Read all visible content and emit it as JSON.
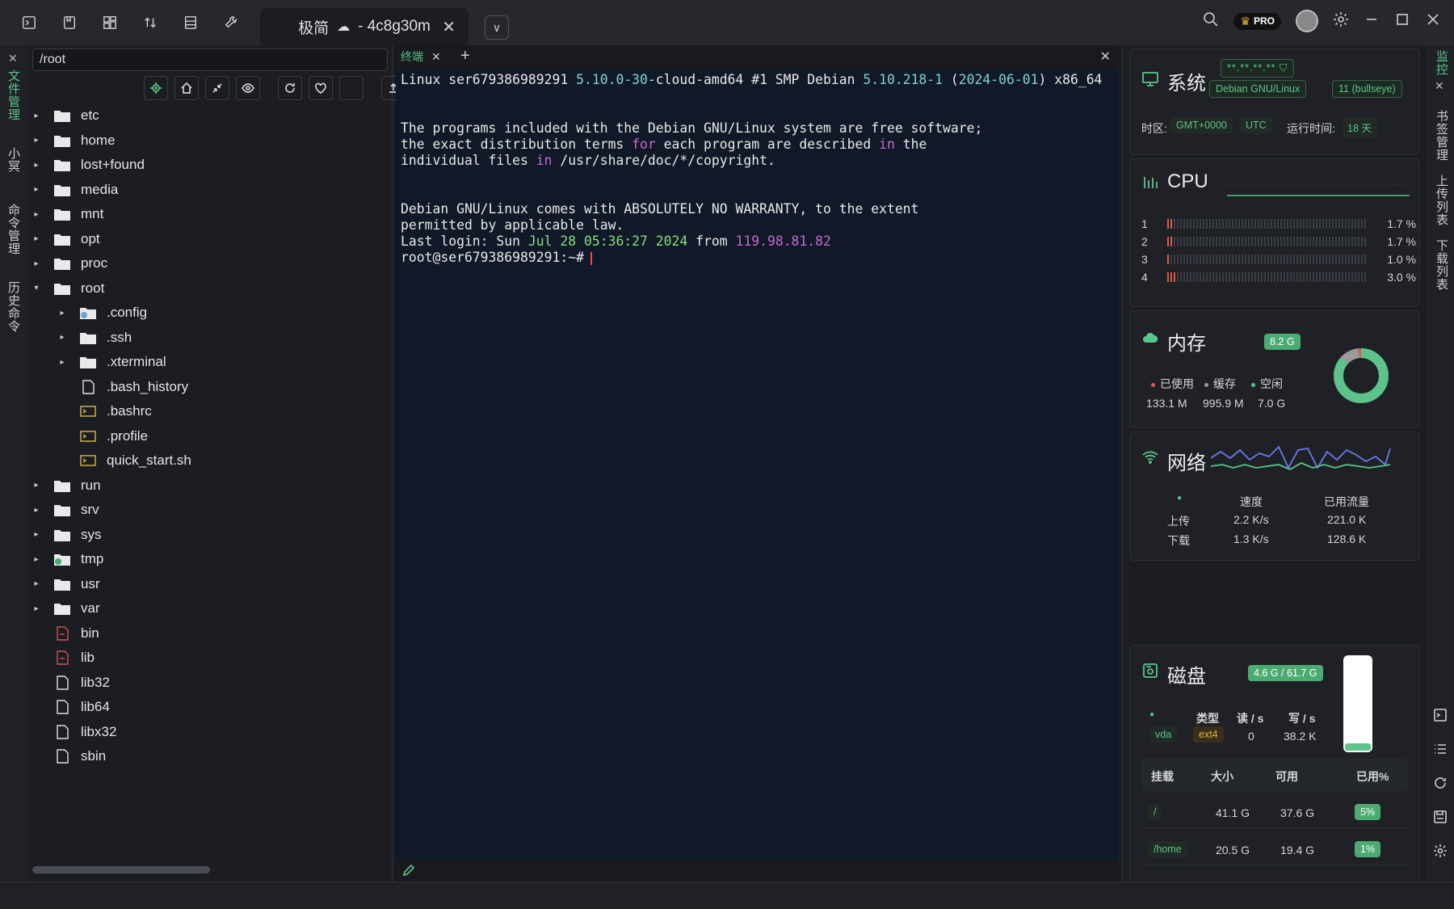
{
  "tab": {
    "title": "极简",
    "host": "- 4c8g30m"
  },
  "left_tabs": [
    "文件管理",
    "小冥",
    "命令管理",
    "历史命令"
  ],
  "right_tabs": [
    "监控",
    "书签管理",
    "上传列表",
    "下载列表"
  ],
  "file_panel": {
    "path": "/root",
    "items": [
      {
        "name": "etc",
        "type": "folder",
        "depth": 0,
        "arrow": "▸"
      },
      {
        "name": "home",
        "type": "folder",
        "depth": 0,
        "arrow": "▸"
      },
      {
        "name": "lost+found",
        "type": "folder",
        "depth": 0,
        "arrow": "▸"
      },
      {
        "name": "media",
        "type": "folder",
        "depth": 0,
        "arrow": "▸"
      },
      {
        "name": "mnt",
        "type": "folder",
        "depth": 0,
        "arrow": "▸"
      },
      {
        "name": "opt",
        "type": "folder",
        "depth": 0,
        "arrow": "▸"
      },
      {
        "name": "proc",
        "type": "folder",
        "depth": 0,
        "arrow": "▸"
      },
      {
        "name": "root",
        "type": "folder",
        "depth": 0,
        "arrow": "▾"
      },
      {
        "name": ".config",
        "type": "folder-gear",
        "depth": 1,
        "arrow": "▸"
      },
      {
        "name": ".ssh",
        "type": "folder",
        "depth": 1,
        "arrow": "▸"
      },
      {
        "name": ".xterminal",
        "type": "folder",
        "depth": 1,
        "arrow": "▸"
      },
      {
        "name": ".bash_history",
        "type": "file",
        "depth": 1,
        "arrow": ""
      },
      {
        "name": ".bashrc",
        "type": "shell",
        "depth": 1,
        "arrow": ""
      },
      {
        "name": ".profile",
        "type": "shell",
        "depth": 1,
        "arrow": ""
      },
      {
        "name": "quick_start.sh",
        "type": "shell",
        "depth": 1,
        "arrow": ""
      },
      {
        "name": "run",
        "type": "folder",
        "depth": 0,
        "arrow": "▸"
      },
      {
        "name": "srv",
        "type": "folder",
        "depth": 0,
        "arrow": "▸"
      },
      {
        "name": "sys",
        "type": "folder",
        "depth": 0,
        "arrow": "▸"
      },
      {
        "name": "tmp",
        "type": "folder-clock",
        "depth": 0,
        "arrow": "▸"
      },
      {
        "name": "usr",
        "type": "folder",
        "depth": 0,
        "arrow": "▸"
      },
      {
        "name": "var",
        "type": "folder",
        "depth": 0,
        "arrow": "▸"
      },
      {
        "name": "bin",
        "type": "link",
        "depth": 0,
        "arrow": ""
      },
      {
        "name": "lib",
        "type": "link",
        "depth": 0,
        "arrow": ""
      },
      {
        "name": "lib32",
        "type": "file",
        "depth": 0,
        "arrow": ""
      },
      {
        "name": "lib64",
        "type": "file",
        "depth": 0,
        "arrow": ""
      },
      {
        "name": "libx32",
        "type": "file",
        "depth": 0,
        "arrow": ""
      },
      {
        "name": "sbin",
        "type": "file",
        "depth": 0,
        "arrow": ""
      }
    ]
  },
  "terminal": {
    "tab_label": "终端",
    "line1_a": "Linux ser679386989291 ",
    "line1_b": "5.10.0-30",
    "line1_c": "-cloud-amd64 #1 SMP Debian ",
    "line1_d": "5.10.218-1",
    "line1_e": " (",
    "line1_f": "2024-06-01",
    "line1_g": ") x86_64",
    "line2": "The programs included with the Debian GNU/Linux system are free software;",
    "line3_a": "the exact distribution terms ",
    "line3_b": "for",
    "line3_c": " each program are described ",
    "line3_d": "in",
    "line3_e": " the",
    "line4_a": "individual files ",
    "line4_b": "in",
    "line4_c": " /usr/share/doc/*/copyright.",
    "line5": "Debian GNU/Linux comes with ABSOLUTELY NO WARRANTY, to the extent",
    "line6": "permitted by applicable law.",
    "line7_a": "Last login: Sun ",
    "line7_b": "Jul 28 05:36:27 2024",
    "line7_c": " from ",
    "line7_d": "119.98.81.82",
    "prompt": "root@ser679386989291:~#"
  },
  "monitor": {
    "system": {
      "title": "系统",
      "ip_mask": "**.**.**.**",
      "os": "Debian GNU/Linux",
      "version": "11 (bullseye)",
      "tz_label": "时区:",
      "tz_value": "GMT+0000",
      "tz_name": "UTC",
      "uptime_label": "运行时间:",
      "uptime_value": "18 天"
    },
    "cpu": {
      "title": "CPU",
      "cores": [
        {
          "id": "1",
          "pct": 1.7,
          "label": "1.7 %"
        },
        {
          "id": "2",
          "pct": 1.7,
          "label": "1.7 %"
        },
        {
          "id": "3",
          "pct": 1.0,
          "label": "1.0 %"
        },
        {
          "id": "4",
          "pct": 3.0,
          "label": "3.0 %"
        }
      ]
    },
    "memory": {
      "title": "内存",
      "total": "8.2 G",
      "used_label": "已使用",
      "cache_label": "缓存",
      "free_label": "空闲",
      "used": "133.1 M",
      "cache": "995.9 M",
      "free": "7.0 G",
      "ring_fractions": {
        "used": 0.016,
        "cache": 0.118,
        "free": 0.866
      }
    },
    "network": {
      "title": "网络",
      "speed_label": "速度",
      "traffic_label": "已用流量",
      "up_label": "上传",
      "down_label": "下载",
      "up_speed": "2.2 K/s",
      "up_traffic": "221.0 K",
      "down_speed": "1.3 K/s",
      "down_traffic": "128.6 K"
    },
    "disk": {
      "title": "磁盘",
      "usage": "4.6 G / 61.7 G",
      "usage_fraction": 0.075,
      "type_label": "类型",
      "read_label": "读 / s",
      "write_label": "写 / s",
      "device": "vda",
      "fs": "ext4",
      "read": "0",
      "write": "38.2 K",
      "cols": [
        "挂载",
        "大小",
        "可用",
        "已用%"
      ],
      "mounts": [
        {
          "mount": "/",
          "size": "41.1 G",
          "avail": "37.6 G",
          "pct": "5%"
        },
        {
          "mount": "/home",
          "size": "20.5 G",
          "avail": "19.4 G",
          "pct": "1%"
        }
      ]
    }
  },
  "colors": {
    "accent": "#5cc48a",
    "bg": "#1b1d22",
    "term_bg": "#111827",
    "bar_red": "#e2574c"
  }
}
